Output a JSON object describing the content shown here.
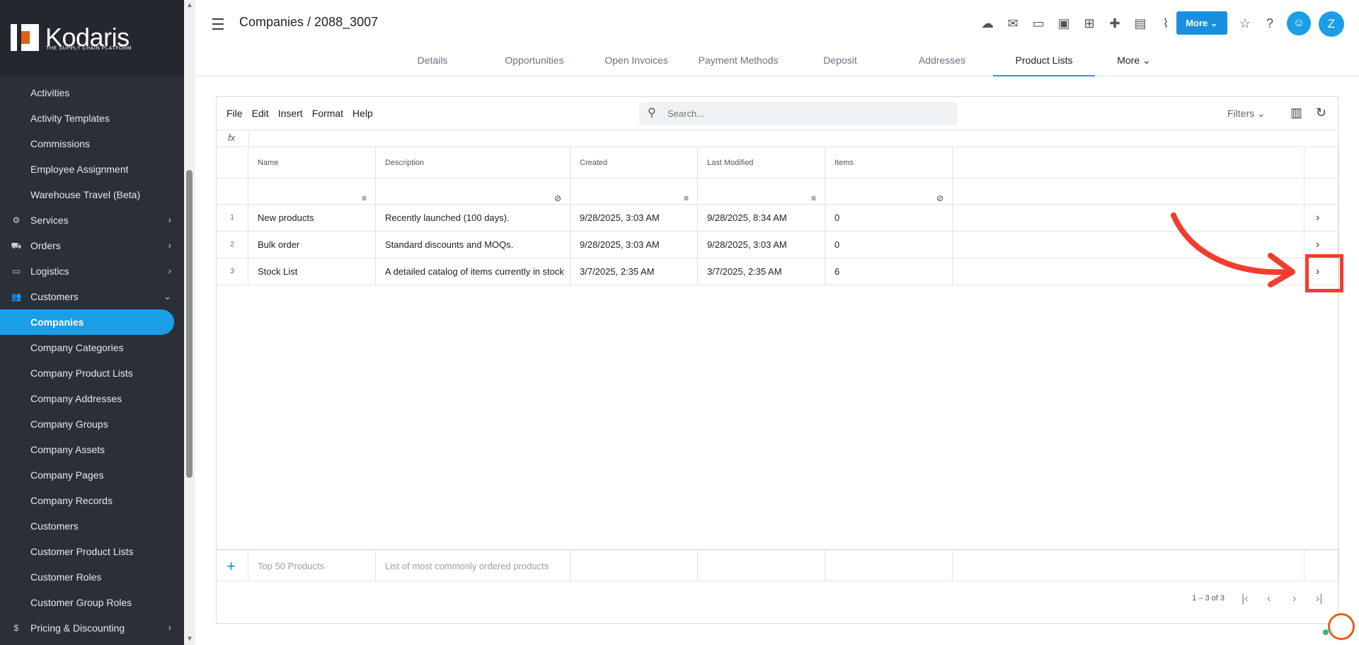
{
  "brand": {
    "name": "Kodaris",
    "tagline": "THE SUPPLY CHAIN PLATFORM"
  },
  "sidebar": {
    "items": [
      {
        "label": "Activities",
        "type": "child"
      },
      {
        "label": "Activity Templates",
        "type": "child"
      },
      {
        "label": "Commissions",
        "type": "child"
      },
      {
        "label": "Employee Assignment",
        "type": "child"
      },
      {
        "label": "Warehouse Travel (Beta)",
        "type": "child"
      },
      {
        "label": "Services",
        "type": "group",
        "icon": "services-icon",
        "chevron": "›"
      },
      {
        "label": "Orders",
        "type": "group",
        "icon": "truck-icon",
        "chevron": "›"
      },
      {
        "label": "Logistics",
        "type": "group",
        "icon": "shipping-icon",
        "chevron": "›"
      },
      {
        "label": "Customers",
        "type": "group",
        "icon": "people-icon",
        "chevron": "⌄"
      },
      {
        "label": "Companies",
        "type": "child",
        "active": true
      },
      {
        "label": "Company Categories",
        "type": "child"
      },
      {
        "label": "Company Product Lists",
        "type": "child"
      },
      {
        "label": "Company Addresses",
        "type": "child"
      },
      {
        "label": "Company Groups",
        "type": "child"
      },
      {
        "label": "Company Assets",
        "type": "child"
      },
      {
        "label": "Company Pages",
        "type": "child"
      },
      {
        "label": "Company Records",
        "type": "child"
      },
      {
        "label": "Customers",
        "type": "child"
      },
      {
        "label": "Customer Product Lists",
        "type": "child"
      },
      {
        "label": "Customer Roles",
        "type": "child"
      },
      {
        "label": "Customer Group Roles",
        "type": "child"
      },
      {
        "label": "Pricing & Discounting",
        "type": "group",
        "icon": "dollar-icon",
        "chevron": "›"
      }
    ]
  },
  "header": {
    "title": "Companies / 2088_3007",
    "more_label": "More",
    "avatar_initial": "Z",
    "icons": [
      "cloud-download-icon",
      "mail-icon",
      "card-icon",
      "gift-card-icon",
      "add-screen-icon",
      "add-person-icon",
      "add-file-icon",
      "attachment-icon"
    ],
    "tabs": [
      {
        "label": "Details"
      },
      {
        "label": "Opportunities"
      },
      {
        "label": "Open Invoices"
      },
      {
        "label": "Payment Methods"
      },
      {
        "label": "Deposit"
      },
      {
        "label": "Addresses"
      },
      {
        "label": "Product Lists",
        "active": true
      },
      {
        "label": "More"
      }
    ]
  },
  "sheet": {
    "menu": [
      "File",
      "Edit",
      "Insert",
      "Format",
      "Help"
    ],
    "search_placeholder": "Search...",
    "filters_label": "Filters",
    "fx_label": "fx",
    "columns": [
      "Name",
      "Description",
      "Created",
      "Last Modified",
      "Items"
    ],
    "rows": [
      {
        "num": "1",
        "name": "New products",
        "description": "Recently launched (100 days).",
        "created": "9/28/2025, 3:03 AM",
        "modified": "9/28/2025, 8:34 AM",
        "items": "0"
      },
      {
        "num": "2",
        "name": "Bulk order",
        "description": "Standard discounts and MOQs.",
        "created": "9/28/2025, 3:03 AM",
        "modified": "9/28/2025, 3:03 AM",
        "items": "0"
      },
      {
        "num": "3",
        "name": "Stock List",
        "description": "A detailed catalog of items currently in stock",
        "created": "3/7/2025, 2:35 AM",
        "modified": "3/7/2025, 2:35 AM",
        "items": "6"
      }
    ],
    "new_row": {
      "name_placeholder": "Top 50 Products",
      "description_placeholder": "List of most commonly ordered products"
    },
    "pager_text": "1 – 3 of 3"
  },
  "colors": {
    "accent": "#1a9ee6",
    "annotation": "#f23d2e",
    "sidebar": "#2b3038"
  }
}
